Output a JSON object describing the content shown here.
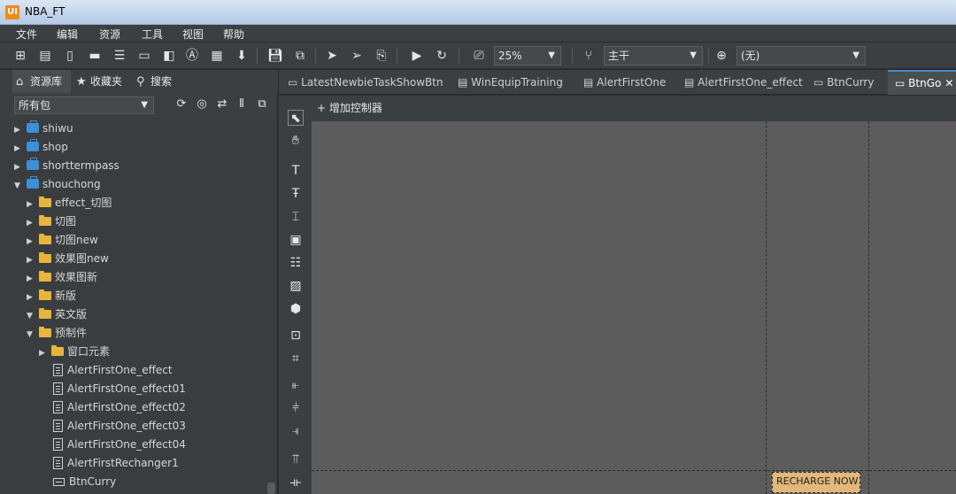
{
  "window": {
    "title": "NBA_FT",
    "app_icon": "UI"
  },
  "menu": [
    "文件",
    "编辑",
    "资源",
    "工具",
    "视图",
    "帮助"
  ],
  "toolbar": {
    "zoom": "25%",
    "branch_label": "主干",
    "language_label": "(无)"
  },
  "left_panel": {
    "tabs": [
      "资源库",
      "收藏夹",
      "搜索"
    ],
    "package_select": "所有包",
    "tree": [
      {
        "label": "shiwu",
        "type": "package",
        "level": 0,
        "expanded": false
      },
      {
        "label": "shop",
        "type": "package",
        "level": 0,
        "expanded": false
      },
      {
        "label": "shorttermpass",
        "type": "package",
        "level": 0,
        "expanded": false
      },
      {
        "label": "shouchong",
        "type": "package",
        "level": 0,
        "expanded": true
      },
      {
        "label": "effect_切图",
        "type": "folder",
        "level": 1,
        "expanded": false
      },
      {
        "label": "切图",
        "type": "folder",
        "level": 1,
        "expanded": false
      },
      {
        "label": "切图new",
        "type": "folder",
        "level": 1,
        "expanded": false
      },
      {
        "label": "效果图new",
        "type": "folder",
        "level": 1,
        "expanded": false
      },
      {
        "label": "效果图新",
        "type": "folder",
        "level": 1,
        "expanded": false
      },
      {
        "label": "新版",
        "type": "folder",
        "level": 1,
        "expanded": false
      },
      {
        "label": "英文版",
        "type": "folder",
        "level": 1,
        "expanded": true
      },
      {
        "label": "预制件",
        "type": "folder",
        "level": 1,
        "expanded": true
      },
      {
        "label": "窗口元素",
        "type": "folder",
        "level": 2,
        "expanded": false
      },
      {
        "label": "AlertFirstOne_effect",
        "type": "component",
        "level": 2
      },
      {
        "label": "AlertFirstOne_effect01",
        "type": "component",
        "level": 2
      },
      {
        "label": "AlertFirstOne_effect02",
        "type": "component",
        "level": 2
      },
      {
        "label": "AlertFirstOne_effect03",
        "type": "component",
        "level": 2
      },
      {
        "label": "AlertFirstOne_effect04",
        "type": "component",
        "level": 2
      },
      {
        "label": "AlertFirstRechanger1",
        "type": "component",
        "level": 2
      },
      {
        "label": "BtnCurry",
        "type": "button",
        "level": 2
      }
    ]
  },
  "doc_tabs": [
    {
      "label": "LatestNewbieTaskShowBtn",
      "active": false
    },
    {
      "label": "WinEquipTraining",
      "active": false
    },
    {
      "label": "AlertFirstOne",
      "active": false
    },
    {
      "label": "AlertFirstOne_effect",
      "active": false
    },
    {
      "label": "BtnCurry",
      "active": false
    },
    {
      "label": "BtnGo",
      "active": true,
      "close": "✕"
    }
  ],
  "editor": {
    "add_controller": "+ 增加控制器",
    "preview_button_text": "RECHARGE NOW"
  },
  "colors": {
    "panel_bg": "#3c3f41",
    "canvas_bg": "#5c5c5c",
    "accent": "#4a88c7",
    "folder": "#e8b53c",
    "package": "#3d8fd6"
  }
}
